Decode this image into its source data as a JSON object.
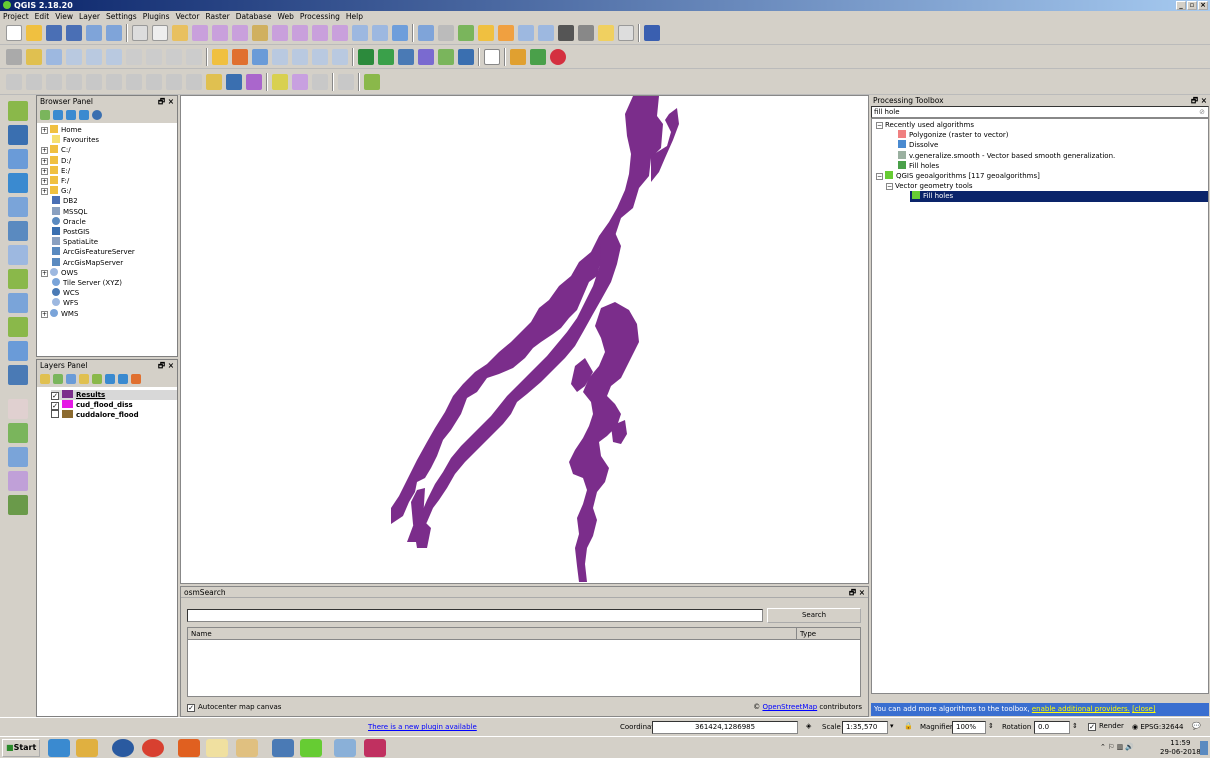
{
  "app": {
    "title": "QGIS 2.18.20"
  },
  "menu": [
    "Project",
    "Edit",
    "View",
    "Layer",
    "Settings",
    "Plugins",
    "Vector",
    "Raster",
    "Database",
    "Web",
    "Processing",
    "Help"
  ],
  "browser_panel": {
    "title": "Browser Panel",
    "items": [
      "Home",
      "Favourites",
      "C:/",
      "D:/",
      "E:/",
      "F:/",
      "G:/",
      "DB2",
      "MSSQL",
      "Oracle",
      "PostGIS",
      "SpatiaLite",
      "ArcGisFeatureServer",
      "ArcGisMapServer",
      "OWS",
      "Tile Server (XYZ)",
      "WCS",
      "WFS",
      "WMS"
    ]
  },
  "layers_panel": {
    "title": "Layers Panel",
    "layers": [
      {
        "name": "Results",
        "checked": "✓",
        "color": "#7b2d8b"
      },
      {
        "name": "cud_flood_diss",
        "checked": "✓",
        "color": "#e619e6"
      },
      {
        "name": "cuddalore_flood",
        "checked": "",
        "color": "#8b6a2f"
      }
    ]
  },
  "osm": {
    "title": "osmSearch",
    "search_label": "Search",
    "col_name": "Name",
    "col_type": "Type",
    "autocenter_label": "Autocenter map canvas",
    "credit_prefix": "©",
    "credit_link": "OpenStreetMap",
    "credit_suffix": "contributors"
  },
  "processing": {
    "title": "Processing Toolbox",
    "search_value": "fill hole",
    "recent_group": "Recently used algorithms",
    "recent": [
      "Polygonize (raster to vector)",
      "Dissolve",
      "v.generalize.smooth - Vector based smooth generalization.",
      "Fill holes"
    ],
    "qgis_group": "QGIS geoalgorithms [117 geoalgorithms]",
    "vector_group": "Vector geometry tools",
    "selected": "Fill holes",
    "footer_text": "You can add more algorithms to the toolbox,",
    "footer_link": "enable additional providers.",
    "footer_close": "[close]"
  },
  "status": {
    "plugin_notice": "There is a new plugin available",
    "coordinate_label": "Coordinate",
    "coordinate_value": "361424,1286985",
    "scale_label": "Scale",
    "scale_value": "1:35,570",
    "magnifier_label": "Magnifier",
    "magnifier_value": "100%",
    "rotation_label": "Rotation",
    "rotation_value": "0.0",
    "render_label": "Render",
    "crs": "EPSG:32644"
  },
  "taskbar": {
    "start_label": "Start",
    "clock_time": "11:59",
    "clock_date": "29-06-2018"
  },
  "colors": {
    "polygon": "#7b2d8b",
    "selection": "#0a246a"
  }
}
